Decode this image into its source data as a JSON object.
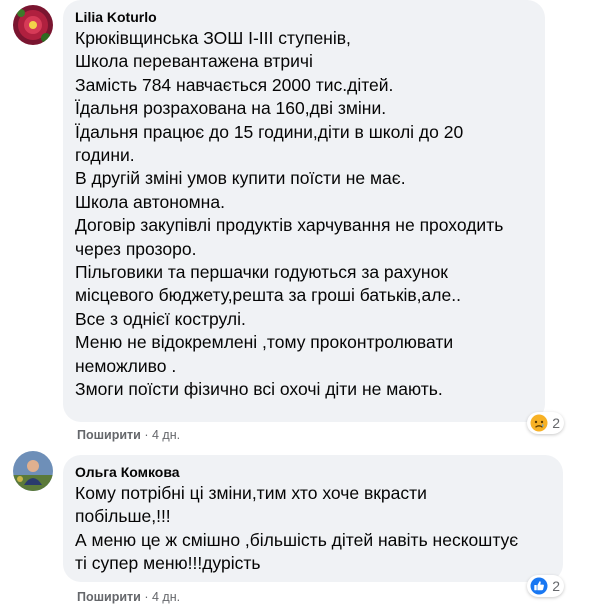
{
  "comments": [
    {
      "author": "Lilia Koturlo",
      "lines": [
        "Крюківщинська ЗОШ I-III ступенів,",
        "Школа перевантажена втричі",
        "Замість 784 навчається 2000 тис.дітей.",
        "Їдальня розрахована на 160,дві зміни.",
        "Їдальня працює до 15 години,діти в школі до 20",
        "години.",
        "В другій зміні умов купити поїсти не має.",
        "Школа автономна.",
        "Договір закупівлі продуктів харчування не проходить",
        "через прозоро.",
        "Пільговики та першачки годуються за рахунок",
        "місцевого бюджету,решта за гроші батьків,але..",
        "Все з однієї кострулі.",
        "Меню не відокремлені ,тому проконтролювати",
        "неможливо .",
        "Змоги поїсти фізично всі охочі діти не мають."
      ],
      "share_label": "Поширити",
      "separator": "·",
      "time": "4 дн.",
      "reaction": {
        "icon": "sad-face-icon",
        "count": "2",
        "color": "#f7b125"
      }
    },
    {
      "author": "Ольга Комкова",
      "lines": [
        "Кому потрібні ці зміни,тим хто хоче вкрасти",
        "побільше,!!!",
        "А меню це ж смішно ,більшість дітей навіть нескоштує",
        "ті супер меню!!!дурість"
      ],
      "share_label": "Поширити",
      "separator": "·",
      "time": "4 дн.",
      "reaction": {
        "icon": "like-thumb-icon",
        "count": "2",
        "color": "#1877f2"
      }
    }
  ]
}
